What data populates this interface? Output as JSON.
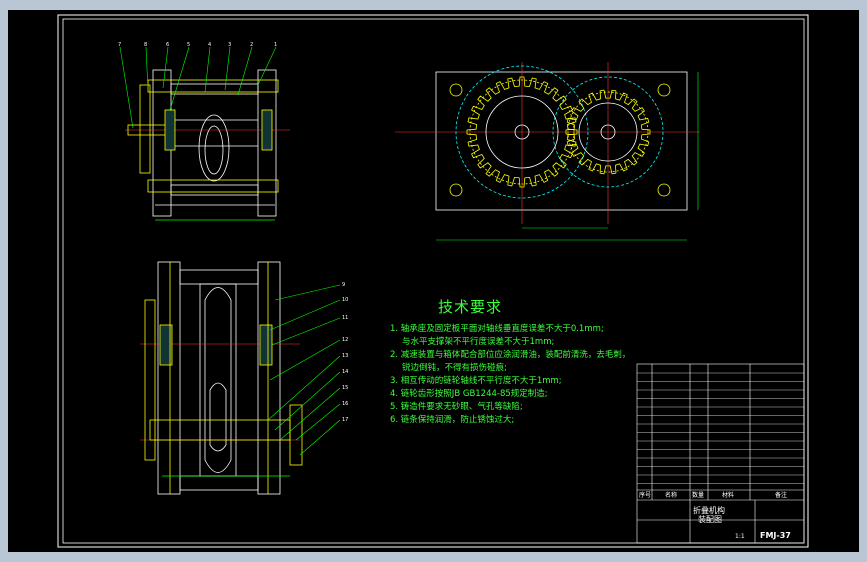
{
  "drawing": {
    "title_zh": "技术要求",
    "requirements": [
      "1. 轴承座及固定板平面对轴线垂直度误差不大于0.1mm;",
      "与水平支撑架不平行度误差不大于1mm;",
      "2. 减速装置与箱体配合部位应涂润滑油，装配前清洗，去毛刺，",
      "锐边倒钝，不得有损伤碰痕;",
      "3. 相互传动的链轮轴线不平行度不大于1mm;",
      "4. 链轮齿形按照JB GB1244-85规定制造;",
      "5. 铸造件要求无砂眼、气孔等缺陷;",
      "6. 链条保持润滑，防止锈蚀过大;"
    ],
    "title_block": {
      "name_line1": "折叠机构",
      "name_line2": "装配图",
      "drawing_no": "FMJ-37",
      "scale": "1:1"
    },
    "bom_header": [
      "序号",
      "名称",
      "数量",
      "材料",
      "备注"
    ],
    "callouts_top": [
      "7",
      "8",
      "6",
      "5",
      "4",
      "3",
      "2",
      "1"
    ],
    "callouts_side": [
      "9",
      "10",
      "11",
      "12",
      "13",
      "14",
      "15",
      "16",
      "17"
    ]
  },
  "colors": {
    "outline": "#ffffff",
    "gear": "#ffff00",
    "hidden": "#00ffff",
    "center": "#ff3333",
    "leader": "#00ff00",
    "frame": "#ffffff",
    "magenta": "#ff00ff"
  }
}
